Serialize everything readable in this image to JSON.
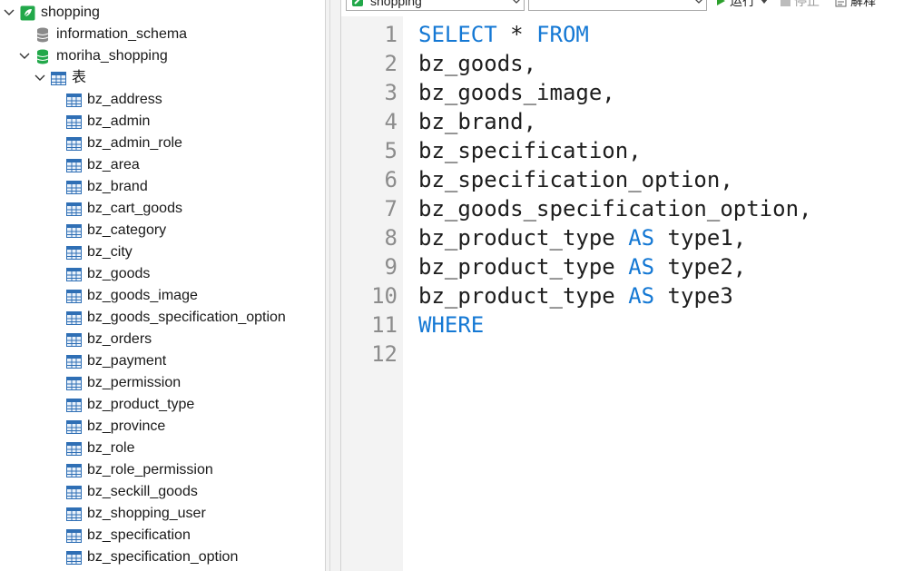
{
  "tree": {
    "root": {
      "label": "shopping",
      "expanded": true
    },
    "schemas": [
      {
        "label": "information_schema",
        "expanded": false
      },
      {
        "label": "moriha_shopping",
        "expanded": true
      }
    ],
    "tables_group": {
      "label": "表",
      "expanded": true
    },
    "tables": [
      "bz_address",
      "bz_admin",
      "bz_admin_role",
      "bz_area",
      "bz_brand",
      "bz_cart_goods",
      "bz_category",
      "bz_city",
      "bz_goods",
      "bz_goods_image",
      "bz_goods_specification_option",
      "bz_orders",
      "bz_payment",
      "bz_permission",
      "bz_product_type",
      "bz_province",
      "bz_role",
      "bz_role_permission",
      "bz_seckill_goods",
      "bz_shopping_user",
      "bz_specification",
      "bz_specification_option"
    ]
  },
  "toolbar": {
    "connection_combo": {
      "value": "shopping"
    },
    "database_combo": {
      "value": ""
    },
    "run_label": "运行",
    "stop_label": "停止",
    "explain_label": "解释"
  },
  "editor": {
    "lines": [
      [
        {
          "t": "SELECT",
          "k": true
        },
        {
          "t": " * ",
          "k": false
        },
        {
          "t": "FROM",
          "k": true
        }
      ],
      [
        {
          "t": "bz_goods,",
          "k": false
        }
      ],
      [
        {
          "t": "bz_goods_image,",
          "k": false
        }
      ],
      [
        {
          "t": "bz_brand,",
          "k": false
        }
      ],
      [
        {
          "t": "bz_specification,",
          "k": false
        }
      ],
      [
        {
          "t": "bz_specification_option,",
          "k": false
        }
      ],
      [
        {
          "t": "bz_goods_specification_option,",
          "k": false
        }
      ],
      [
        {
          "t": "bz_product_type ",
          "k": false
        },
        {
          "t": "AS",
          "k": true
        },
        {
          "t": " type1,",
          "k": false
        }
      ],
      [
        {
          "t": "bz_product_type ",
          "k": false
        },
        {
          "t": "AS",
          "k": true
        },
        {
          "t": " type2,",
          "k": false
        }
      ],
      [
        {
          "t": "bz_product_type ",
          "k": false
        },
        {
          "t": "AS",
          "k": true
        },
        {
          "t": " type3",
          "k": false
        }
      ],
      [
        {
          "t": "WHERE",
          "k": true
        }
      ],
      []
    ]
  },
  "colors": {
    "keyword": "#1478d4",
    "line_number": "#8c8c8c",
    "gutter_bg": "#f3f3f3",
    "db_green": "#22a84a",
    "table_icon": "#2f6fb5",
    "run_green": "#2ca02c"
  }
}
